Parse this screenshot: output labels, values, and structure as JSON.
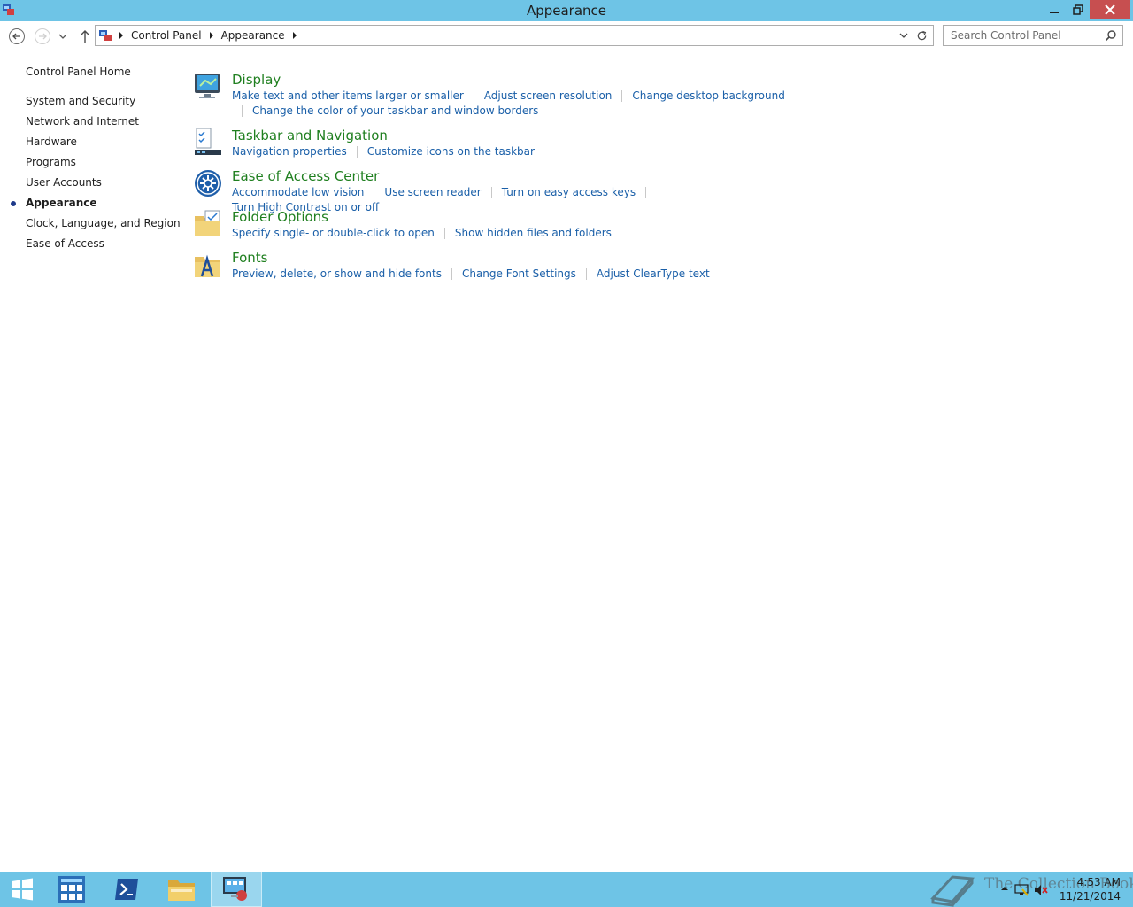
{
  "window": {
    "title": "Appearance"
  },
  "navbar": {
    "breadcrumbs": [
      "Control Panel",
      "Appearance"
    ],
    "search_placeholder": "Search Control Panel"
  },
  "sidebar": {
    "items": [
      {
        "label": "Control Panel Home",
        "active": false
      },
      {
        "label": "System and Security",
        "active": false
      },
      {
        "label": "Network and Internet",
        "active": false
      },
      {
        "label": "Hardware",
        "active": false
      },
      {
        "label": "Programs",
        "active": false
      },
      {
        "label": "User Accounts",
        "active": false
      },
      {
        "label": "Appearance",
        "active": true
      },
      {
        "label": "Clock, Language, and Region",
        "active": false
      },
      {
        "label": "Ease of Access",
        "active": false
      }
    ]
  },
  "categories": [
    {
      "title": "Display",
      "icon": "display-icon",
      "links": [
        "Make text and other items larger or smaller",
        "Adjust screen resolution",
        "Change desktop background",
        "Change the color of your taskbar and window borders"
      ]
    },
    {
      "title": "Taskbar and Navigation",
      "icon": "taskbar-icon",
      "links": [
        "Navigation properties",
        "Customize icons on the taskbar"
      ]
    },
    {
      "title": "Ease of Access Center",
      "icon": "ease-of-access-icon",
      "links": [
        "Accommodate low vision",
        "Use screen reader",
        "Turn on easy access keys",
        "Turn High Contrast on or off"
      ]
    },
    {
      "title": "Folder Options",
      "icon": "folder-options-icon",
      "links": [
        "Specify single- or double-click to open",
        "Show hidden files and folders"
      ]
    },
    {
      "title": "Fonts",
      "icon": "fonts-icon",
      "links": [
        "Preview, delete, or show and hide fonts",
        "Change Font Settings",
        "Adjust ClearType text"
      ]
    }
  ],
  "taskbar": {
    "clock_time": "4:53 AM",
    "clock_date": "11/21/2014",
    "watermark": "The Collection Book"
  },
  "colors": {
    "chrome": "#6ec4e6",
    "link": "#1a5fa8",
    "category_title": "#1f7f1f",
    "close_button": "#c74f50"
  }
}
